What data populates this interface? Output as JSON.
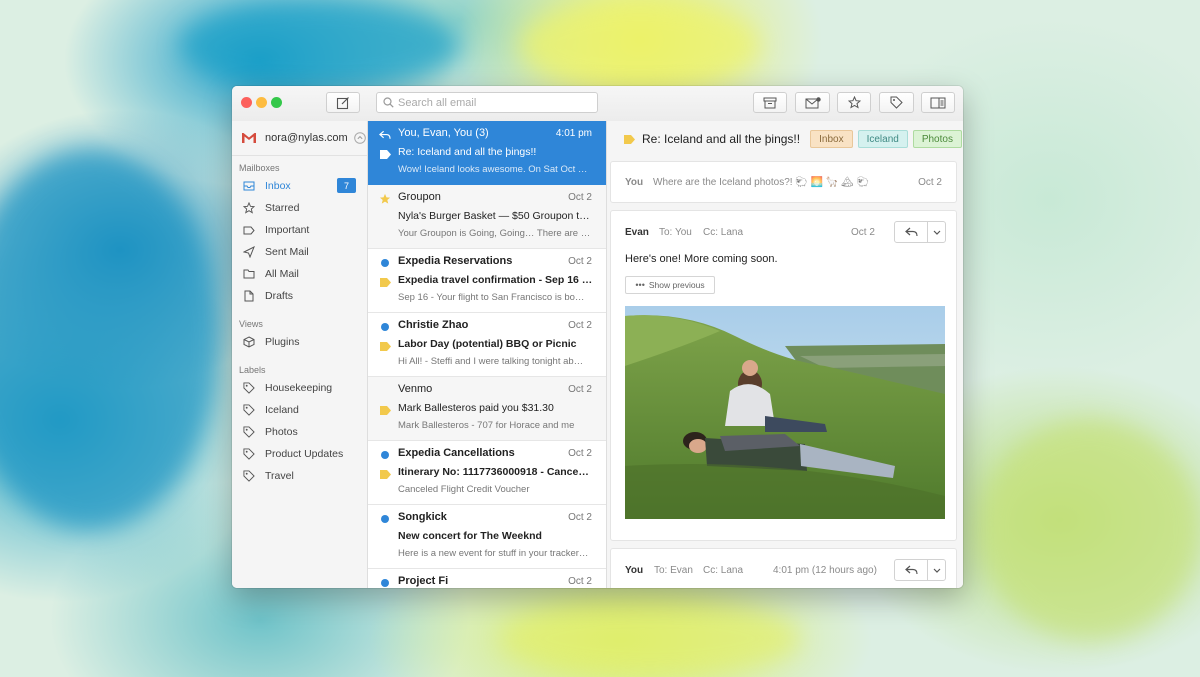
{
  "window": {
    "traffic_colors": [
      "#fc605c",
      "#fdbc40",
      "#34c84a"
    ],
    "search_placeholder": "Search all email"
  },
  "toolbar": {
    "compose_icon": "compose-icon",
    "buttons": [
      "archive-icon",
      "mark-unread-icon",
      "star-icon",
      "tag-icon",
      "sidebar-toggle-icon"
    ]
  },
  "sidebar": {
    "account": "nora@nylas.com",
    "mailboxes_heading": "Mailboxes",
    "mailboxes": [
      {
        "label": "Inbox",
        "icon": "inbox-icon",
        "count": "7",
        "active": true
      },
      {
        "label": "Starred",
        "icon": "star-icon"
      },
      {
        "label": "Important",
        "icon": "important-icon"
      },
      {
        "label": "Sent Mail",
        "icon": "send-icon"
      },
      {
        "label": "All Mail",
        "icon": "folder-icon"
      },
      {
        "label": "Drafts",
        "icon": "draft-icon"
      }
    ],
    "views_heading": "Views",
    "views": [
      {
        "label": "Plugins",
        "icon": "plugin-icon"
      }
    ],
    "labels_heading": "Labels",
    "labels": [
      {
        "label": "Housekeeping"
      },
      {
        "label": "Iceland"
      },
      {
        "label": "Photos"
      },
      {
        "label": "Product Updates"
      },
      {
        "label": "Travel"
      }
    ]
  },
  "threads": [
    {
      "from": "You, Evan, You (3)",
      "date": "4:01 pm",
      "subject": "Re: Iceland and all the þings!!",
      "snippet": "Wow! Iceland looks awesome. On Sat Oct …",
      "state": "selected",
      "lead": "reply",
      "tag": "white"
    },
    {
      "from": "Groupon",
      "date": "Oct 2",
      "subject": "Nyla's Burger Basket — $50 Groupon t…",
      "snippet": "Your Groupon is Going, Going… There are …",
      "state": "read",
      "lead": "star",
      "tag": ""
    },
    {
      "from": "Expedia Reservations",
      "date": "Oct 2",
      "subject": "Expedia travel confirmation - Sep 16 …",
      "snippet": "Sep 16 - Your flight to San Francisco is bo…",
      "state": "unread",
      "lead": "dot",
      "tag": "yellow"
    },
    {
      "from": "Christie Zhao",
      "date": "Oct 2",
      "subject": "Labor Day (potential) BBQ or Picnic",
      "snippet": "Hi All! - Steffi and I were talking tonight ab…",
      "state": "unread",
      "lead": "dot",
      "tag": "yellow"
    },
    {
      "from": "Venmo",
      "date": "Oct 2",
      "subject": "Mark Ballesteros paid you $31.30",
      "snippet": "Mark Ballesteros - 707 for Horace and me",
      "state": "read",
      "lead": "",
      "tag": "yellow"
    },
    {
      "from": "Expedia Cancellations",
      "date": "Oct 2",
      "subject": "Itinerary No: 1117736000918 - Cance…",
      "snippet": "Canceled Flight Credit Voucher",
      "state": "unread",
      "lead": "dot",
      "tag": "yellow"
    },
    {
      "from": "Songkick",
      "date": "Oct 2",
      "subject": "New concert for The Weeknd",
      "snippet": "Here is a new event for stuff in your tracker…",
      "state": "unread",
      "lead": "dot",
      "tag": ""
    },
    {
      "from": "Project Fi",
      "date": "Oct 2",
      "subject": "",
      "snippet": "",
      "state": "unread",
      "lead": "dot",
      "tag": ""
    }
  ],
  "reader": {
    "subject": "Re: Iceland and all the þings!!",
    "labels": [
      {
        "text": "Inbox",
        "bg": "#f9e2c4",
        "border": "#e9c79a",
        "color": "#8a6a3c"
      },
      {
        "text": "Iceland",
        "bg": "#d5f1ef",
        "border": "#a9ddd8",
        "color": "#3f8a84"
      },
      {
        "text": "Photos",
        "bg": "#dcf3d5",
        "border": "#aedba0",
        "color": "#4b8a3a"
      }
    ],
    "collapsed": {
      "from": "You",
      "snippet": "Where are the Iceland photos?! 🐑 🌅 🦙 🏔 🐑",
      "date": "Oct 2"
    },
    "message": {
      "from": "Evan",
      "to": "To: You",
      "cc": "Cc: Lana",
      "date": "Oct 2",
      "body": "Here's one! More coming soon.",
      "show_previous": "Show previous"
    },
    "footer": {
      "from": "You",
      "to": "To: Evan",
      "cc": "Cc: Lana",
      "date": "4:01 pm (12 hours ago)"
    }
  }
}
